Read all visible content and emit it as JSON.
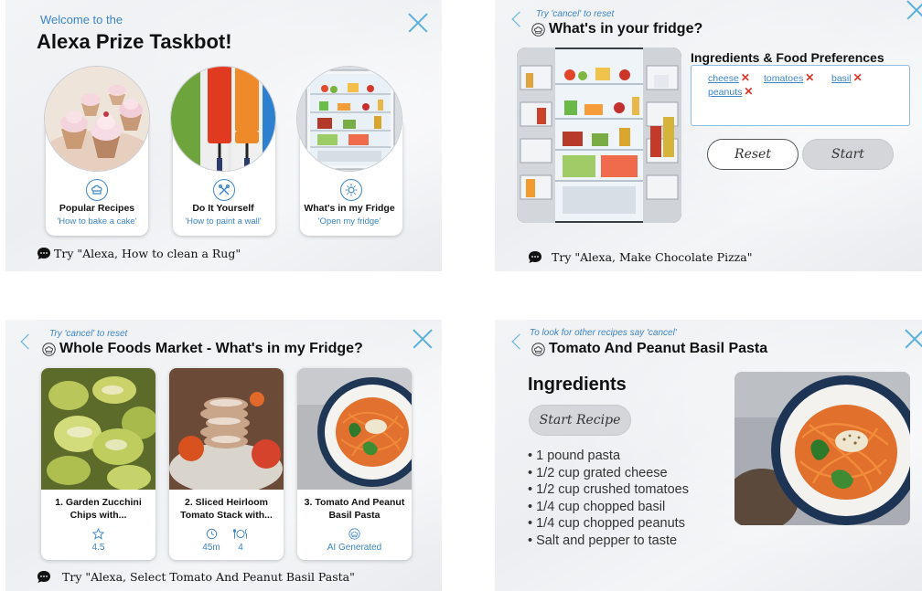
{
  "panel1": {
    "welcome": "Welcome to the",
    "title": "Alexa Prize Taskbot!",
    "categories": [
      {
        "label": "Popular Recipes",
        "sub": "'How to bake a cake'",
        "icon": "chef-hat-icon"
      },
      {
        "label": "Do It Yourself",
        "sub": "'How to paint a wall'",
        "icon": "tools-icon"
      },
      {
        "label": "What's in my Fridge",
        "sub": "'Open my fridge'",
        "icon": "sun-icon"
      }
    ],
    "try": "Try \"Alexa, How to clean a Rug\""
  },
  "panel2": {
    "hint": "Try 'cancel' to reset",
    "title": "What's in your fridge?",
    "pref_heading": "Ingredients & Food Preferences",
    "chips": [
      "cheese",
      "tomatoes",
      "basil",
      "peanuts"
    ],
    "reset_label": "Reset",
    "start_label": "Start",
    "try": "Try \"Alexa, Make Chocolate Pizza\""
  },
  "panel3": {
    "hint": "Try 'cancel' to reset",
    "title": "Whole Foods Market - What's in my Fridge?",
    "recipes": [
      {
        "title": "1. Garden Zucchini Chips with...",
        "rating": "4.5"
      },
      {
        "title": "2. Sliced Heirloom Tomato Stack with...",
        "time": "45m",
        "servings": "4"
      },
      {
        "title": "3. Tomato And Peanut Basil Pasta",
        "badge": "AI Generated"
      }
    ],
    "try": "Try \"Alexa, Select Tomato And Peanut Basil Pasta\""
  },
  "panel4": {
    "hint": "To look for other recipes say 'cancel'",
    "title": "Tomato And Peanut Basil Pasta",
    "ingredients_heading": "Ingredients",
    "start_label": "Start Recipe",
    "ingredients": [
      "1 pound pasta",
      "1/2 cup grated cheese",
      "1/2 cup crushed tomatoes",
      "1/4 cup chopped basil",
      "1/4 cup chopped peanuts",
      "Salt and pepper to taste"
    ]
  },
  "colors": {
    "accent": "#3d86c6",
    "close": "#5ab0dd",
    "remove": "#e0362a"
  }
}
